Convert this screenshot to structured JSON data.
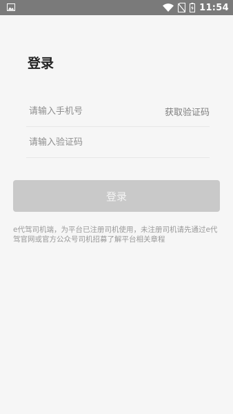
{
  "status_bar": {
    "time": "11:54",
    "icons": [
      "image-icon",
      "wifi-icon",
      "no-sim-icon",
      "battery-charging-icon"
    ]
  },
  "login": {
    "title": "登录",
    "phone_placeholder": "请输入手机号",
    "get_code_label": "获取验证码",
    "code_placeholder": "请输入验证码",
    "submit_label": "登录",
    "notice": "e代驾司机端，为平台已注册司机使用，未注册司机请先通过e代驾官网或官方公众号司机招募了解平台相关章程"
  },
  "colors": {
    "status_bar_bg": "#7a7a7a",
    "page_bg": "#f6f6f6",
    "button_disabled_bg": "#c9c9c9",
    "text_primary": "#222222",
    "text_secondary": "#8e8e8e"
  }
}
